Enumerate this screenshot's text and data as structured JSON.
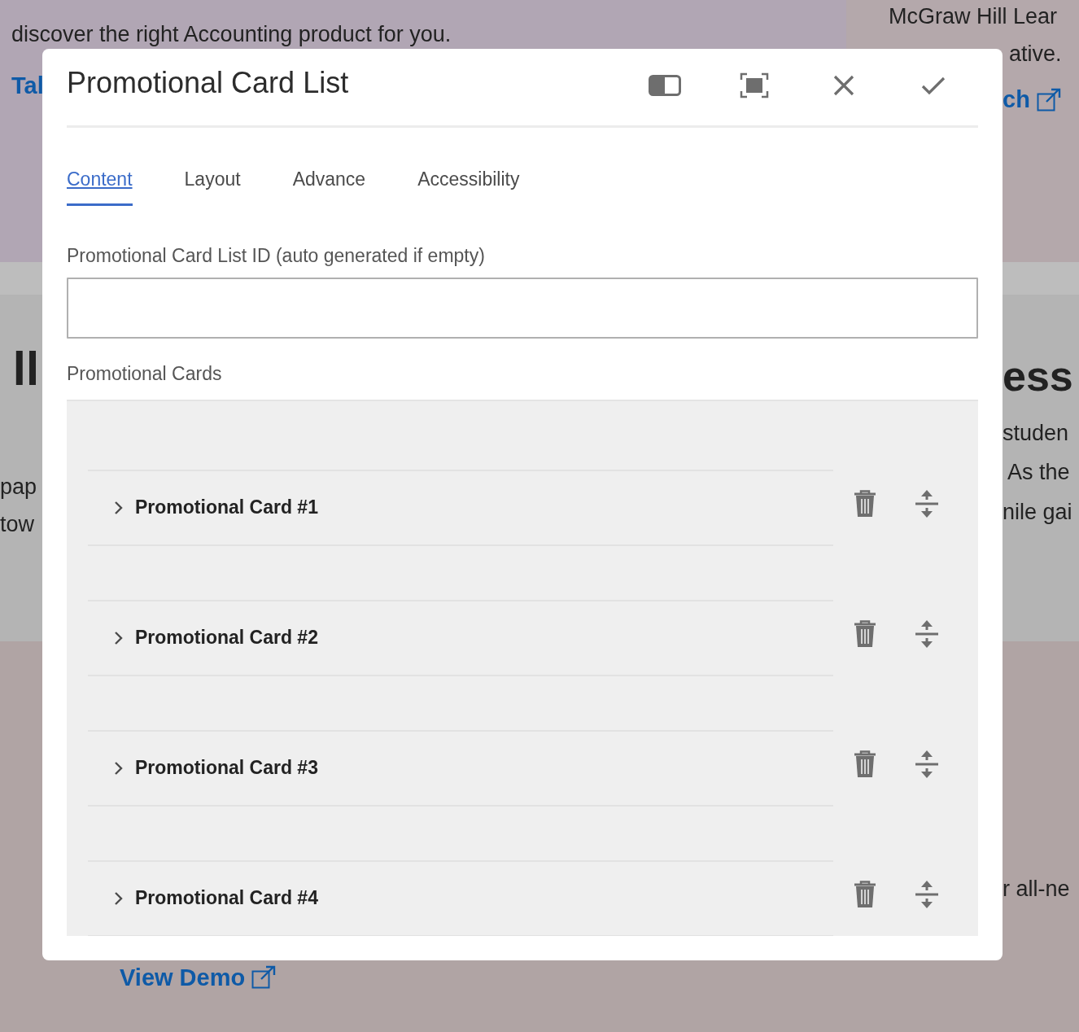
{
  "background": {
    "intro": "discover the right Accounting product for you.",
    "intro_link": "Tal",
    "aside_text": [
      "McGraw Hill Lear",
      "ative."
    ],
    "aside_link": "ch",
    "left_heading": "ll",
    "left_text": [
      "pap",
      "tow"
    ],
    "right_heading": "ess",
    "right_text": [
      "studen",
      "As the",
      "nile gai"
    ],
    "bottom_text": "r all-ne",
    "demo_link": "View Demo"
  },
  "dialog": {
    "title": "Promotional Card List",
    "tabs": [
      {
        "label": "Content",
        "selected": true
      },
      {
        "label": "Layout",
        "selected": false
      },
      {
        "label": "Advance",
        "selected": false
      },
      {
        "label": "Accessibility",
        "selected": false
      }
    ],
    "id_field": {
      "label": "Promotional Card List ID (auto generated if empty)"
    },
    "cards": {
      "label": "Promotional Cards",
      "items": [
        {
          "title": "Promotional Card #1",
          "expanded": false
        },
        {
          "title": "Promotional Card #2",
          "expanded": false
        },
        {
          "title": "Promotional Card #3",
          "expanded": false
        },
        {
          "title": "Promotional Card #4",
          "expanded": false
        }
      ]
    }
  }
}
